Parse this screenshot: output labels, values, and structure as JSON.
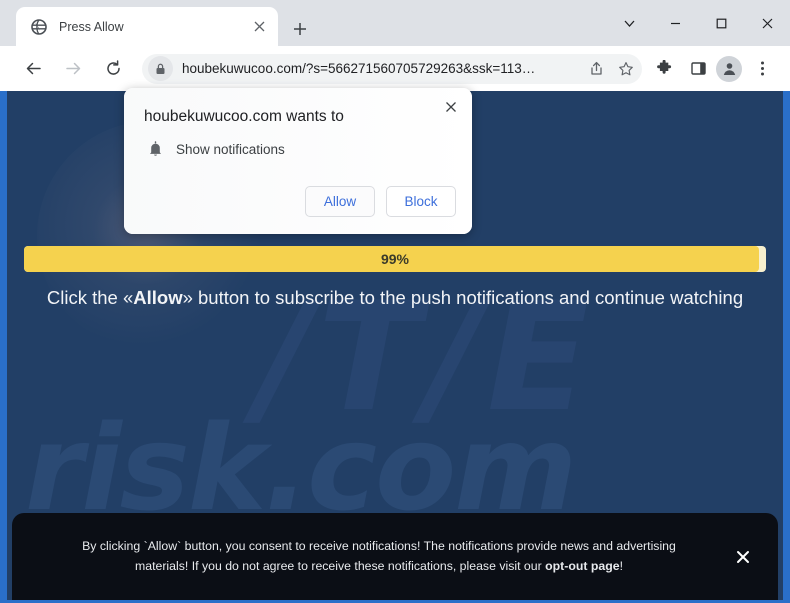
{
  "window": {
    "controls": [
      {
        "name": "tab-search",
        "glyph": "∨"
      },
      {
        "name": "minimize",
        "glyph": "–"
      },
      {
        "name": "maximize",
        "glyph": "□"
      },
      {
        "name": "close",
        "glyph": "✕"
      }
    ],
    "frame_color": "#2a6fc9"
  },
  "tab": {
    "title": "Press Allow",
    "favicon": "globe-icon",
    "close_glyph": "✕",
    "new_tab_glyph": "+"
  },
  "toolbar": {
    "back_label": "←",
    "forward_label": "→",
    "reload_label": "⟳",
    "url": "houbekuwucoo.com/?s=566271560705729263&ssk=113…",
    "lock_icon": "lock-icon",
    "share_icon": "share-icon",
    "star_icon": "bookmark-star-icon",
    "extensions_icon": "puzzle-piece-icon",
    "side_panel_icon": "side-panel-icon",
    "profile_icon": "profile-avatar-icon",
    "menu_icon": "three-dots-menu-icon"
  },
  "dialog": {
    "title": "houbekuwucoo.com wants to",
    "permission_label": "Show notifications",
    "permission_icon": "bell-icon",
    "allow_label": "Allow",
    "block_label": "Block",
    "close_glyph": "✕"
  },
  "page": {
    "progress_percent": 99,
    "progress_label": "99%",
    "progress_color": "#f5d24e",
    "progress_track_color": "#f7f0cf",
    "background_color": "#223f66",
    "headline_prefix": "Click the «Allow»",
    "headline_bold": "Allow",
    "headline_before": "Click the «",
    "headline_after": "» button to subscribe to the push notifications and continue watching",
    "watermark_main": "risk.com",
    "watermark_top": "/T/E"
  },
  "consent_banner": {
    "line1": "By clicking `Allow` button, you consent to receive notifications! The notifications provide news and advertising",
    "line2_before": "materials! If you do not agree to receive these notifications, please visit our ",
    "line2_link": "opt-out page",
    "line2_after": "!",
    "close_glyph": "✕",
    "background_color": "#0b0e15"
  }
}
